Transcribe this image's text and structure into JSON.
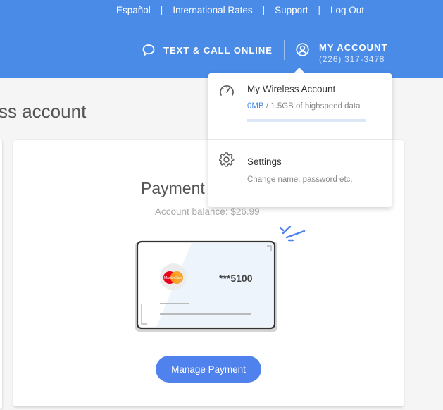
{
  "topbar": {
    "links": [
      "Español",
      "International Rates",
      "Support",
      "Log Out"
    ],
    "separator": "|"
  },
  "nav": {
    "text_call": "TEXT & CALL ONLINE",
    "account_title": "MY ACCOUNT",
    "account_phone": "(226) 317-3478"
  },
  "page": {
    "heading": "ss account"
  },
  "payment": {
    "title": "Payment",
    "balance": "Account balance: $26.99",
    "card_brand_text": "MasterCard",
    "card_number": "***5100",
    "button": "Manage Payment"
  },
  "dropdown": {
    "wireless": {
      "title": "My Wireless Account",
      "used": "0MB",
      "usage_rest": " / 1.5GB of highspeed data",
      "usage_fraction": 0
    },
    "settings": {
      "title": "Settings",
      "subtitle": "Change name, password etc."
    }
  },
  "colors": {
    "header_blue": "#4a8be8",
    "button_blue": "#4f82ec",
    "mastercard_red": "#eb001b",
    "mastercard_yellow": "#f79e1b"
  },
  "icons": {
    "chat": "chat-bubble-icon",
    "account": "user-circle-icon",
    "speed": "speedometer-icon",
    "settings": "gear-icon"
  }
}
